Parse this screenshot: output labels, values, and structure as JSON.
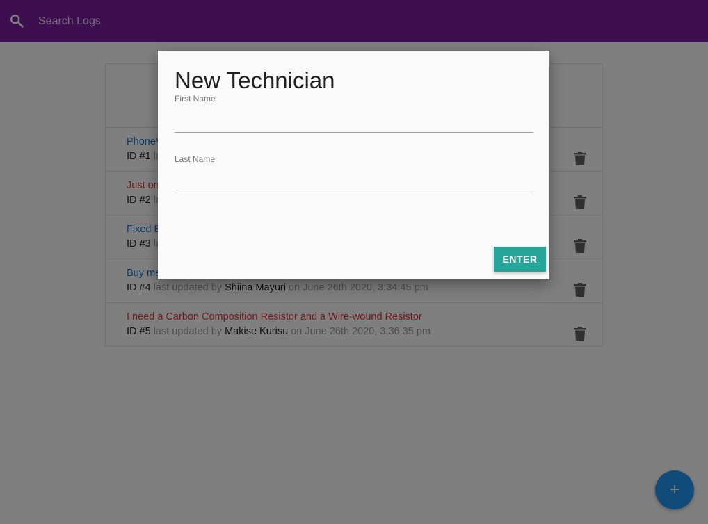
{
  "colors": {
    "navbar": "#7b1fa2",
    "normal_message": "#1976d2",
    "attention_message": "#e53935",
    "enter_button": "#26a69a",
    "fab": "#2196f3"
  },
  "search": {
    "placeholder": "Search Logs",
    "value": "",
    "icon": "search-icon"
  },
  "logs": [
    {
      "message": "PhoneV",
      "attention": false,
      "id_text": "ID #1",
      "meta_text": "la"
    },
    {
      "message": "Just on",
      "attention": true,
      "id_text": "ID #2",
      "meta_text": "la"
    },
    {
      "message": "Fixed B",
      "attention": false,
      "id_text": "ID #3",
      "meta_text": "la"
    },
    {
      "message": "Buy me",
      "attention": false,
      "id_text": "ID #4",
      "updated_by_label": "last updated by",
      "tech": "Shiina Mayuri",
      "date": "on June 26th 2020, 3:34:45 pm"
    },
    {
      "message": "I need a Carbon Composition Resistor and a Wire-wound Resistor",
      "attention": true,
      "id_text": "ID #5",
      "updated_by_label": "last updated by",
      "tech": "Makise Kurisu",
      "date": "on June 26th 2020, 3:36:35 pm"
    }
  ],
  "modal": {
    "title": "New Technician",
    "first_name_label": "First Name",
    "first_name_value": "",
    "last_name_label": "Last Name",
    "last_name_value": "",
    "enter_label": "ENTER"
  },
  "fab": {
    "icon": "plus-icon",
    "glyph": "+"
  }
}
